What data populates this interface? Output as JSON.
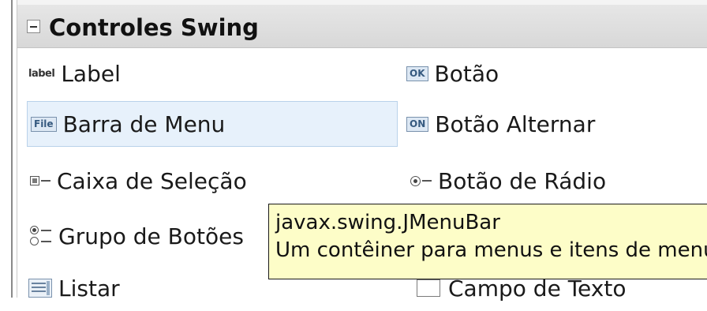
{
  "palette": {
    "section_title": "Controles Swing",
    "items": {
      "label": "Label",
      "button": "Botão",
      "menu_bar": "Barra de Menu",
      "toggle_button": "Botão Alternar",
      "check_box": "Caixa de Seleção",
      "radio_button": "Botão de Rádio",
      "button_group": "Grupo de Botões",
      "list": "Listar",
      "text_field": "Campo de Texto"
    },
    "icon_text": {
      "label": "label",
      "button": "OK",
      "menu_bar": "File",
      "toggle_button": "ON"
    },
    "selected_item": "menu_bar"
  },
  "tooltip": {
    "class_name": "javax.swing.JMenuBar",
    "description": "Um contêiner para menus e itens de menu"
  },
  "colors": {
    "selection_bg": "#e7f1fb",
    "tooltip_bg": "#fdfdc8",
    "header_bg": "#dcdcdc"
  }
}
